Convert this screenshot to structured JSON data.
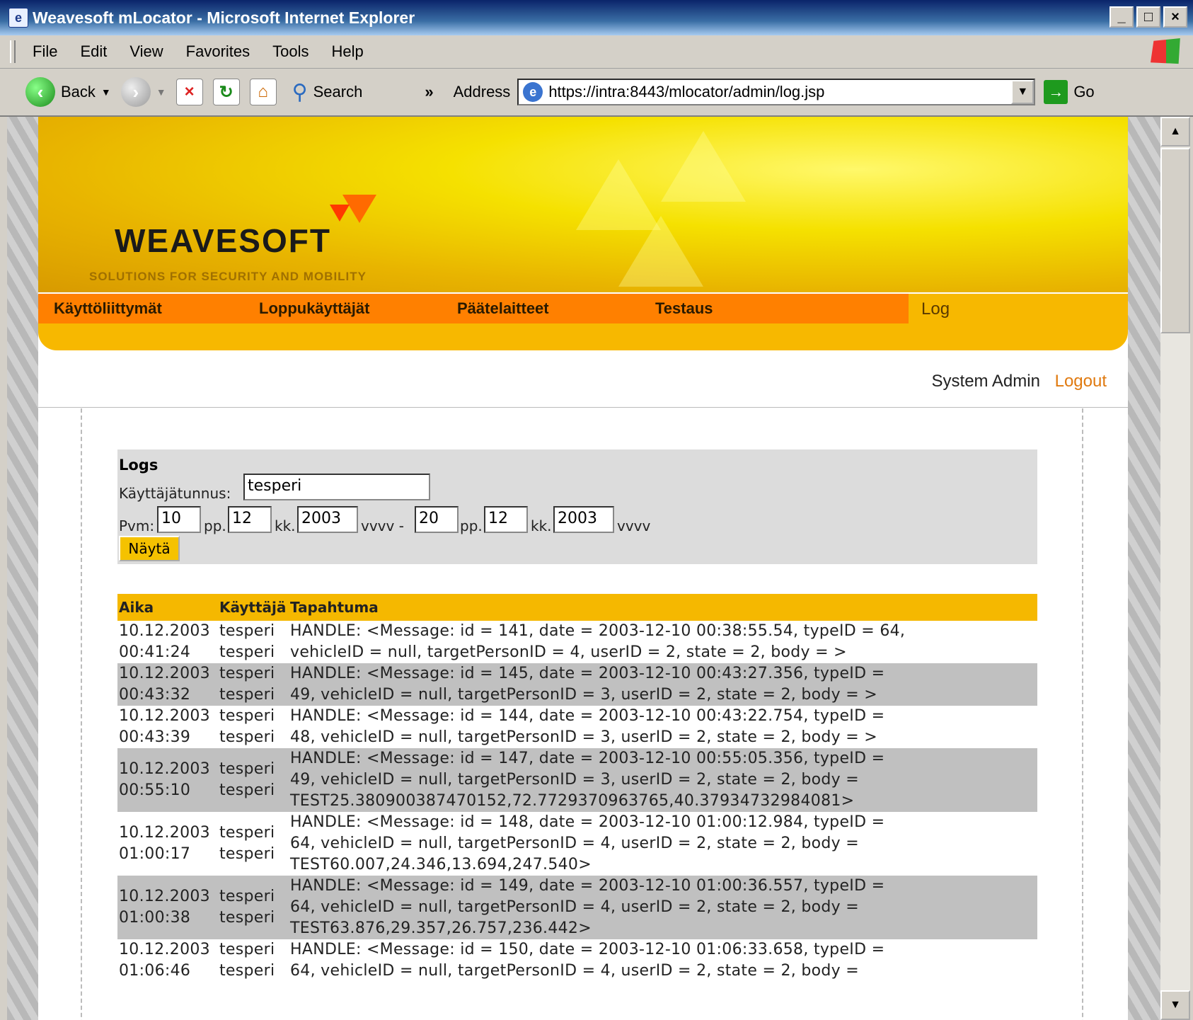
{
  "window": {
    "title": "Weavesoft mLocator - Microsoft Internet Explorer"
  },
  "menu": [
    "File",
    "Edit",
    "View",
    "Favorites",
    "Tools",
    "Help"
  ],
  "toolbar": {
    "back": "Back",
    "search": "Search",
    "more": "»",
    "address_label": "Address",
    "url": "https://intra:8443/mlocator/admin/log.jsp",
    "go": "Go"
  },
  "brand": {
    "logo": "WEAVESOFT",
    "tagline": "SOLUTIONS FOR SECURITY AND MOBILITY"
  },
  "nav": {
    "items": [
      "Käyttöliittymät",
      "Loppukäyttäjät",
      "Päätelaitteet",
      "Testaus"
    ],
    "active": "Log"
  },
  "user": {
    "name": "System Admin",
    "logout": "Logout"
  },
  "form": {
    "heading": "Logs",
    "user_label": "Käyttäjätunnus:",
    "user_value": "tesperi",
    "date_label": "Pvm:",
    "from_dd": "10",
    "dd_label": "pp.",
    "from_mm": "12",
    "mm_label": "kk.",
    "from_yyyy": "2003",
    "yyyy_sep": "vvvv -",
    "to_dd": "20",
    "to_mm": "12",
    "to_yyyy": "2003",
    "yyyy_label": "vvvv",
    "submit": "Näytä"
  },
  "table": {
    "headers": [
      "Aika",
      "Käyttäjä",
      "Tapahtuma"
    ],
    "rows": [
      {
        "time": [
          "10.12.2003",
          "00:41:24"
        ],
        "user": [
          "tesperi",
          "tesperi"
        ],
        "event": [
          "HANDLE: <Message: id = 141, date = 2003-12-10 00:38:55.54, typeID = 64,",
          "vehicleID = null, targetPersonID = 4, userID = 2, state = 2, body = >"
        ]
      },
      {
        "time": [
          "10.12.2003",
          "00:43:32"
        ],
        "user": [
          "tesperi",
          "tesperi"
        ],
        "event": [
          "HANDLE: <Message: id = 145, date = 2003-12-10 00:43:27.356, typeID =",
          "49, vehicleID = null, targetPersonID = 3, userID = 2, state = 2, body = >"
        ]
      },
      {
        "time": [
          "10.12.2003",
          "00:43:39"
        ],
        "user": [
          "tesperi",
          "tesperi"
        ],
        "event": [
          "HANDLE: <Message: id = 144, date = 2003-12-10 00:43:22.754, typeID =",
          "48, vehicleID = null, targetPersonID = 3, userID = 2, state = 2, body = >"
        ]
      },
      {
        "time": [
          "10.12.2003",
          "00:55:10"
        ],
        "user": [
          "tesperi",
          "tesperi"
        ],
        "event": [
          "HANDLE: <Message: id = 147, date = 2003-12-10 00:55:05.356, typeID =",
          "49, vehicleID = null, targetPersonID = 3, userID = 2, state = 2, body =",
          "TEST25.380900387470152,72.7729370963765,40.37934732984081>"
        ]
      },
      {
        "time": [
          "10.12.2003",
          "01:00:17"
        ],
        "user": [
          "tesperi",
          "tesperi"
        ],
        "event": [
          "HANDLE: <Message: id = 148, date = 2003-12-10 01:00:12.984, typeID =",
          "64, vehicleID = null, targetPersonID = 4, userID = 2, state = 2, body =",
          "TEST60.007,24.346,13.694,247.540>"
        ]
      },
      {
        "time": [
          "10.12.2003",
          "01:00:38"
        ],
        "user": [
          "tesperi",
          "tesperi"
        ],
        "event": [
          "HANDLE: <Message: id = 149, date = 2003-12-10 01:00:36.557, typeID =",
          "64, vehicleID = null, targetPersonID = 4, userID = 2, state = 2, body =",
          "TEST63.876,29.357,26.757,236.442>"
        ]
      },
      {
        "time": [
          "10.12.2003",
          "01:06:46"
        ],
        "user": [
          "tesperi",
          "tesperi"
        ],
        "event": [
          "HANDLE: <Message: id = 150, date = 2003-12-10 01:06:33.658, typeID =",
          "64, vehicleID = null, targetPersonID = 4, userID = 2, state = 2, body ="
        ]
      }
    ]
  },
  "colors": {
    "nav_orange": "#ff8000",
    "nav_yellow": "#f7b800",
    "header_yellow": "#f5b800",
    "alt_row": "#c0c0c0",
    "logout": "#e07a10"
  }
}
